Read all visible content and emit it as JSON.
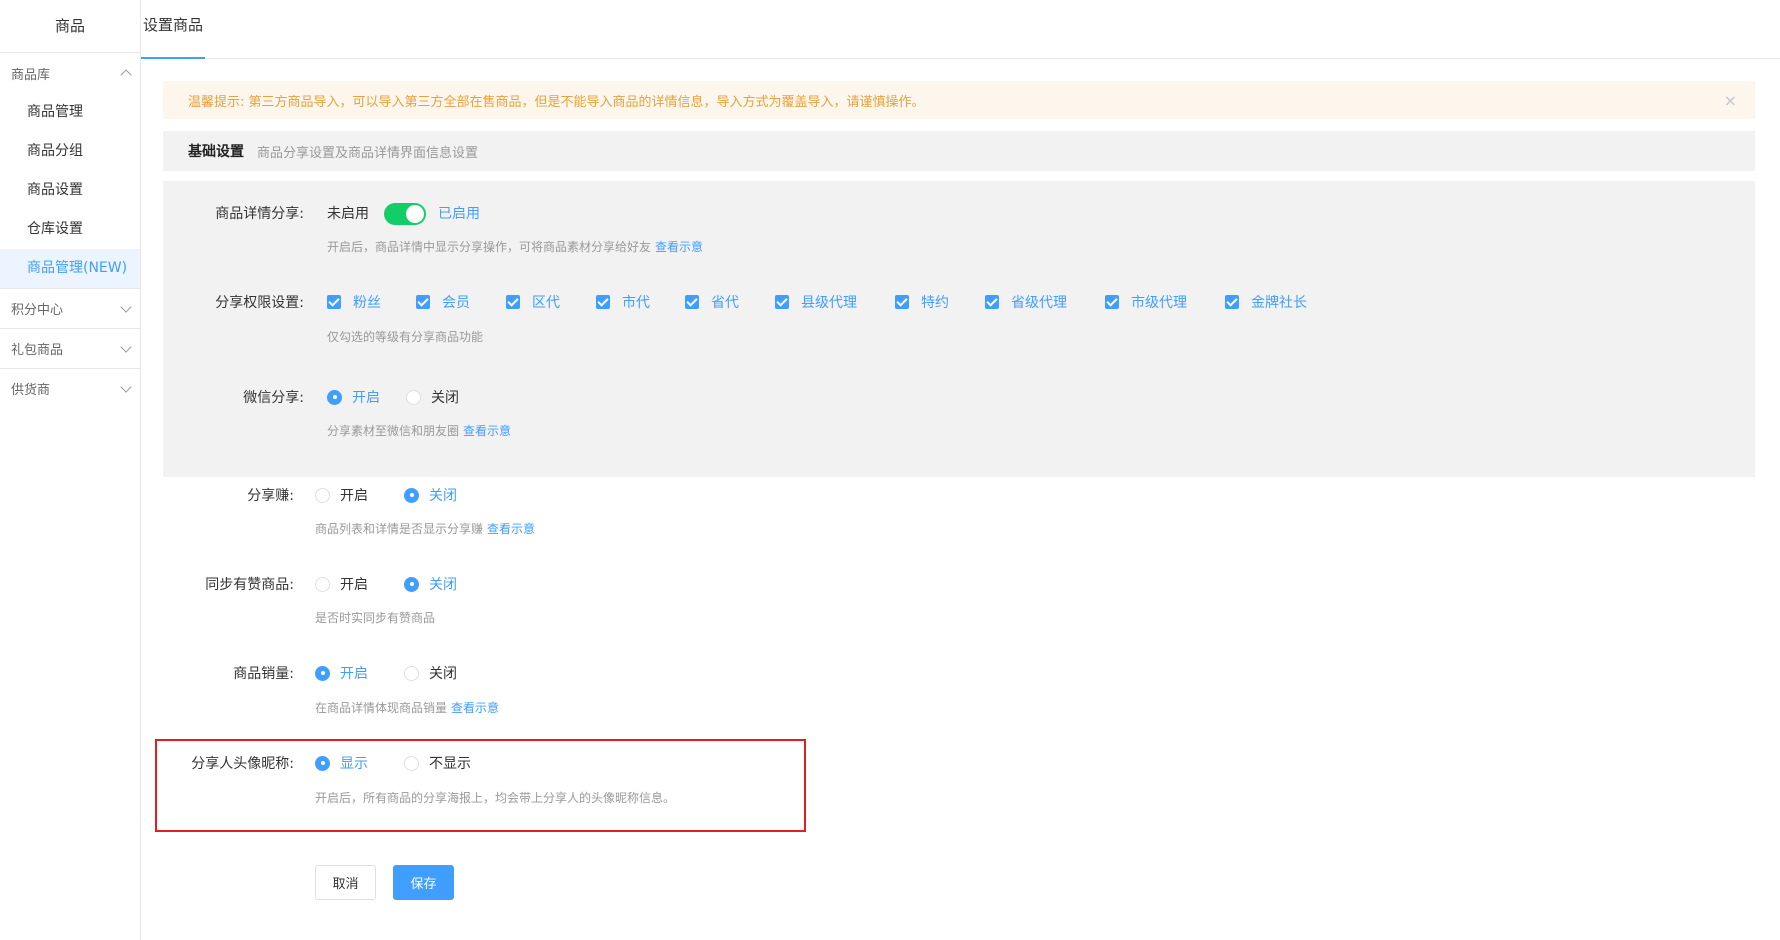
{
  "sidebar": {
    "title": "商品",
    "groups": [
      {
        "label": "商品库",
        "expanded": true,
        "items": [
          {
            "label": "商品管理",
            "active": false
          },
          {
            "label": "商品分组",
            "active": false
          },
          {
            "label": "商品设置",
            "active": false
          },
          {
            "label": "仓库设置",
            "active": false
          },
          {
            "label": "商品管理(NEW)",
            "active": true
          }
        ]
      },
      {
        "label": "积分中心",
        "expanded": false
      },
      {
        "label": "礼包商品",
        "expanded": false
      },
      {
        "label": "供货商",
        "expanded": false
      }
    ]
  },
  "tabs": [
    {
      "label": "设置商品",
      "active": true
    }
  ],
  "alert": {
    "text": "温馨提示: 第三方商品导入，可以导入第三方全部在售商品，但是不能导入商品的详情信息，导入方式为覆盖导入，请谨慎操作。",
    "close": "×"
  },
  "section": {
    "title": "基础设置",
    "subtitle": "商品分享设置及商品详情界面信息设置"
  },
  "form": {
    "detail_share": {
      "label": "商品详情分享:",
      "off_text": "未启用",
      "on_text": "已启用",
      "enabled": true,
      "tip": "开启后，商品详情中显示分享操作，可将商品素材分享给好友",
      "link": "查看示意"
    },
    "share_permission": {
      "label": "分享权限设置:",
      "options": [
        "粉丝",
        "会员",
        "区代",
        "市代",
        "省代",
        "县级代理",
        "特约",
        "省级代理",
        "市级代理",
        "金牌社长"
      ],
      "all_checked": true,
      "tip": "仅勾选的等级有分享商品功能"
    },
    "wechat_share": {
      "label": "微信分享:",
      "options": [
        "开启",
        "关闭"
      ],
      "selected": "开启",
      "tip": "分享素材至微信和朋友圈",
      "link": "查看示意"
    },
    "share_earn": {
      "label": "分享赚:",
      "options": [
        "开启",
        "关闭"
      ],
      "selected": "关闭",
      "tip": "商品列表和详情是否显示分享赚",
      "link": "查看示意"
    },
    "sync_youzan": {
      "label": "同步有赞商品:",
      "options": [
        "开启",
        "关闭"
      ],
      "selected": "关闭",
      "tip": "是否时实同步有赞商品"
    },
    "sales_volume": {
      "label": "商品销量:",
      "options": [
        "开启",
        "关闭"
      ],
      "selected": "开启",
      "tip": "在商品详情体现商品销量",
      "link": "查看示意"
    },
    "sharer_avatar": {
      "label": "分享人头像昵称:",
      "options": [
        "显示",
        "不显示"
      ],
      "selected": "显示",
      "tip": "开启后，所有商品的分享海报上，均会带上分享人的头像昵称信息。"
    }
  },
  "buttons": {
    "cancel": "取消",
    "save": "保存"
  },
  "colors": {
    "primary": "#409eff",
    "switch_on": "#13ce66",
    "warning": "#e6a23c",
    "highlight_border": "#e02020"
  }
}
